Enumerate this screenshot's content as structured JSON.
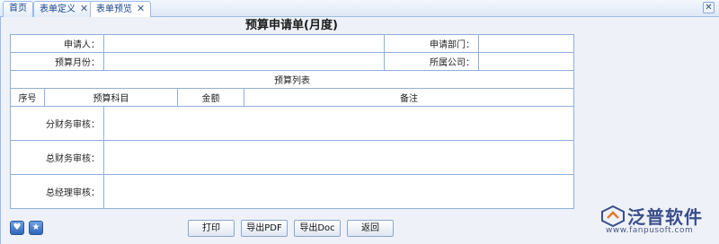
{
  "tabs": [
    {
      "label": "首页",
      "closable": false,
      "active": false
    },
    {
      "label": "表单定义",
      "closable": true,
      "active": false
    },
    {
      "label": "表单预览",
      "closable": true,
      "active": true
    }
  ],
  "form": {
    "title": "预算申请单(月度)",
    "fields": {
      "applicant_label": "申请人：",
      "applicant_value": "",
      "dept_label": "申请部门：",
      "dept_value": "",
      "month_label": "预算月份：",
      "month_value": "",
      "company_label": "所属公司：",
      "company_value": ""
    },
    "list_title": "预算列表",
    "columns": [
      "序号",
      "预算科目",
      "金额",
      "备注"
    ],
    "reviews": [
      {
        "label": "分财务审核：",
        "value": ""
      },
      {
        "label": "总财务审核：",
        "value": ""
      },
      {
        "label": "总经理审核：",
        "value": ""
      }
    ]
  },
  "buttons": {
    "print": "打印",
    "export_pdf": "导出PDF",
    "export_doc": "导出Doc",
    "back": "返回"
  },
  "logo": {
    "name": "泛普软件",
    "url": "www.fanpusoft.com",
    "color": "#3a4e8c"
  },
  "icons": [
    "close-icon",
    "heart-icon",
    "star-icon"
  ]
}
